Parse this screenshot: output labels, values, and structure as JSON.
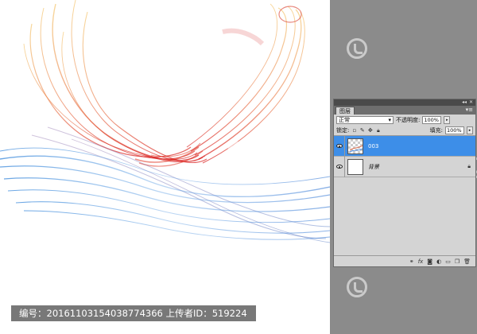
{
  "layers_panel": {
    "title": "图层",
    "blend_mode": "正常",
    "opacity_label": "不透明度:",
    "opacity_value": "100%",
    "lock_label": "锁定:",
    "fill_label": "填充:",
    "fill_value": "100%",
    "layers": [
      {
        "name": "003",
        "selected": true,
        "transparent_thumb": true
      },
      {
        "name": "背景",
        "selected": false,
        "locked": true
      }
    ],
    "bottom_icons": [
      "link-icon",
      "fx-icon",
      "mask-icon",
      "adjustment-icon",
      "group-icon",
      "new-layer-icon",
      "trash-icon"
    ]
  },
  "caption": "编号：20161103154038774366 上传者ID：519224",
  "colors": {
    "selection": "#3d8ee8",
    "panel_bg": "#d4d4d4",
    "workspace": "#8b8b8b"
  }
}
